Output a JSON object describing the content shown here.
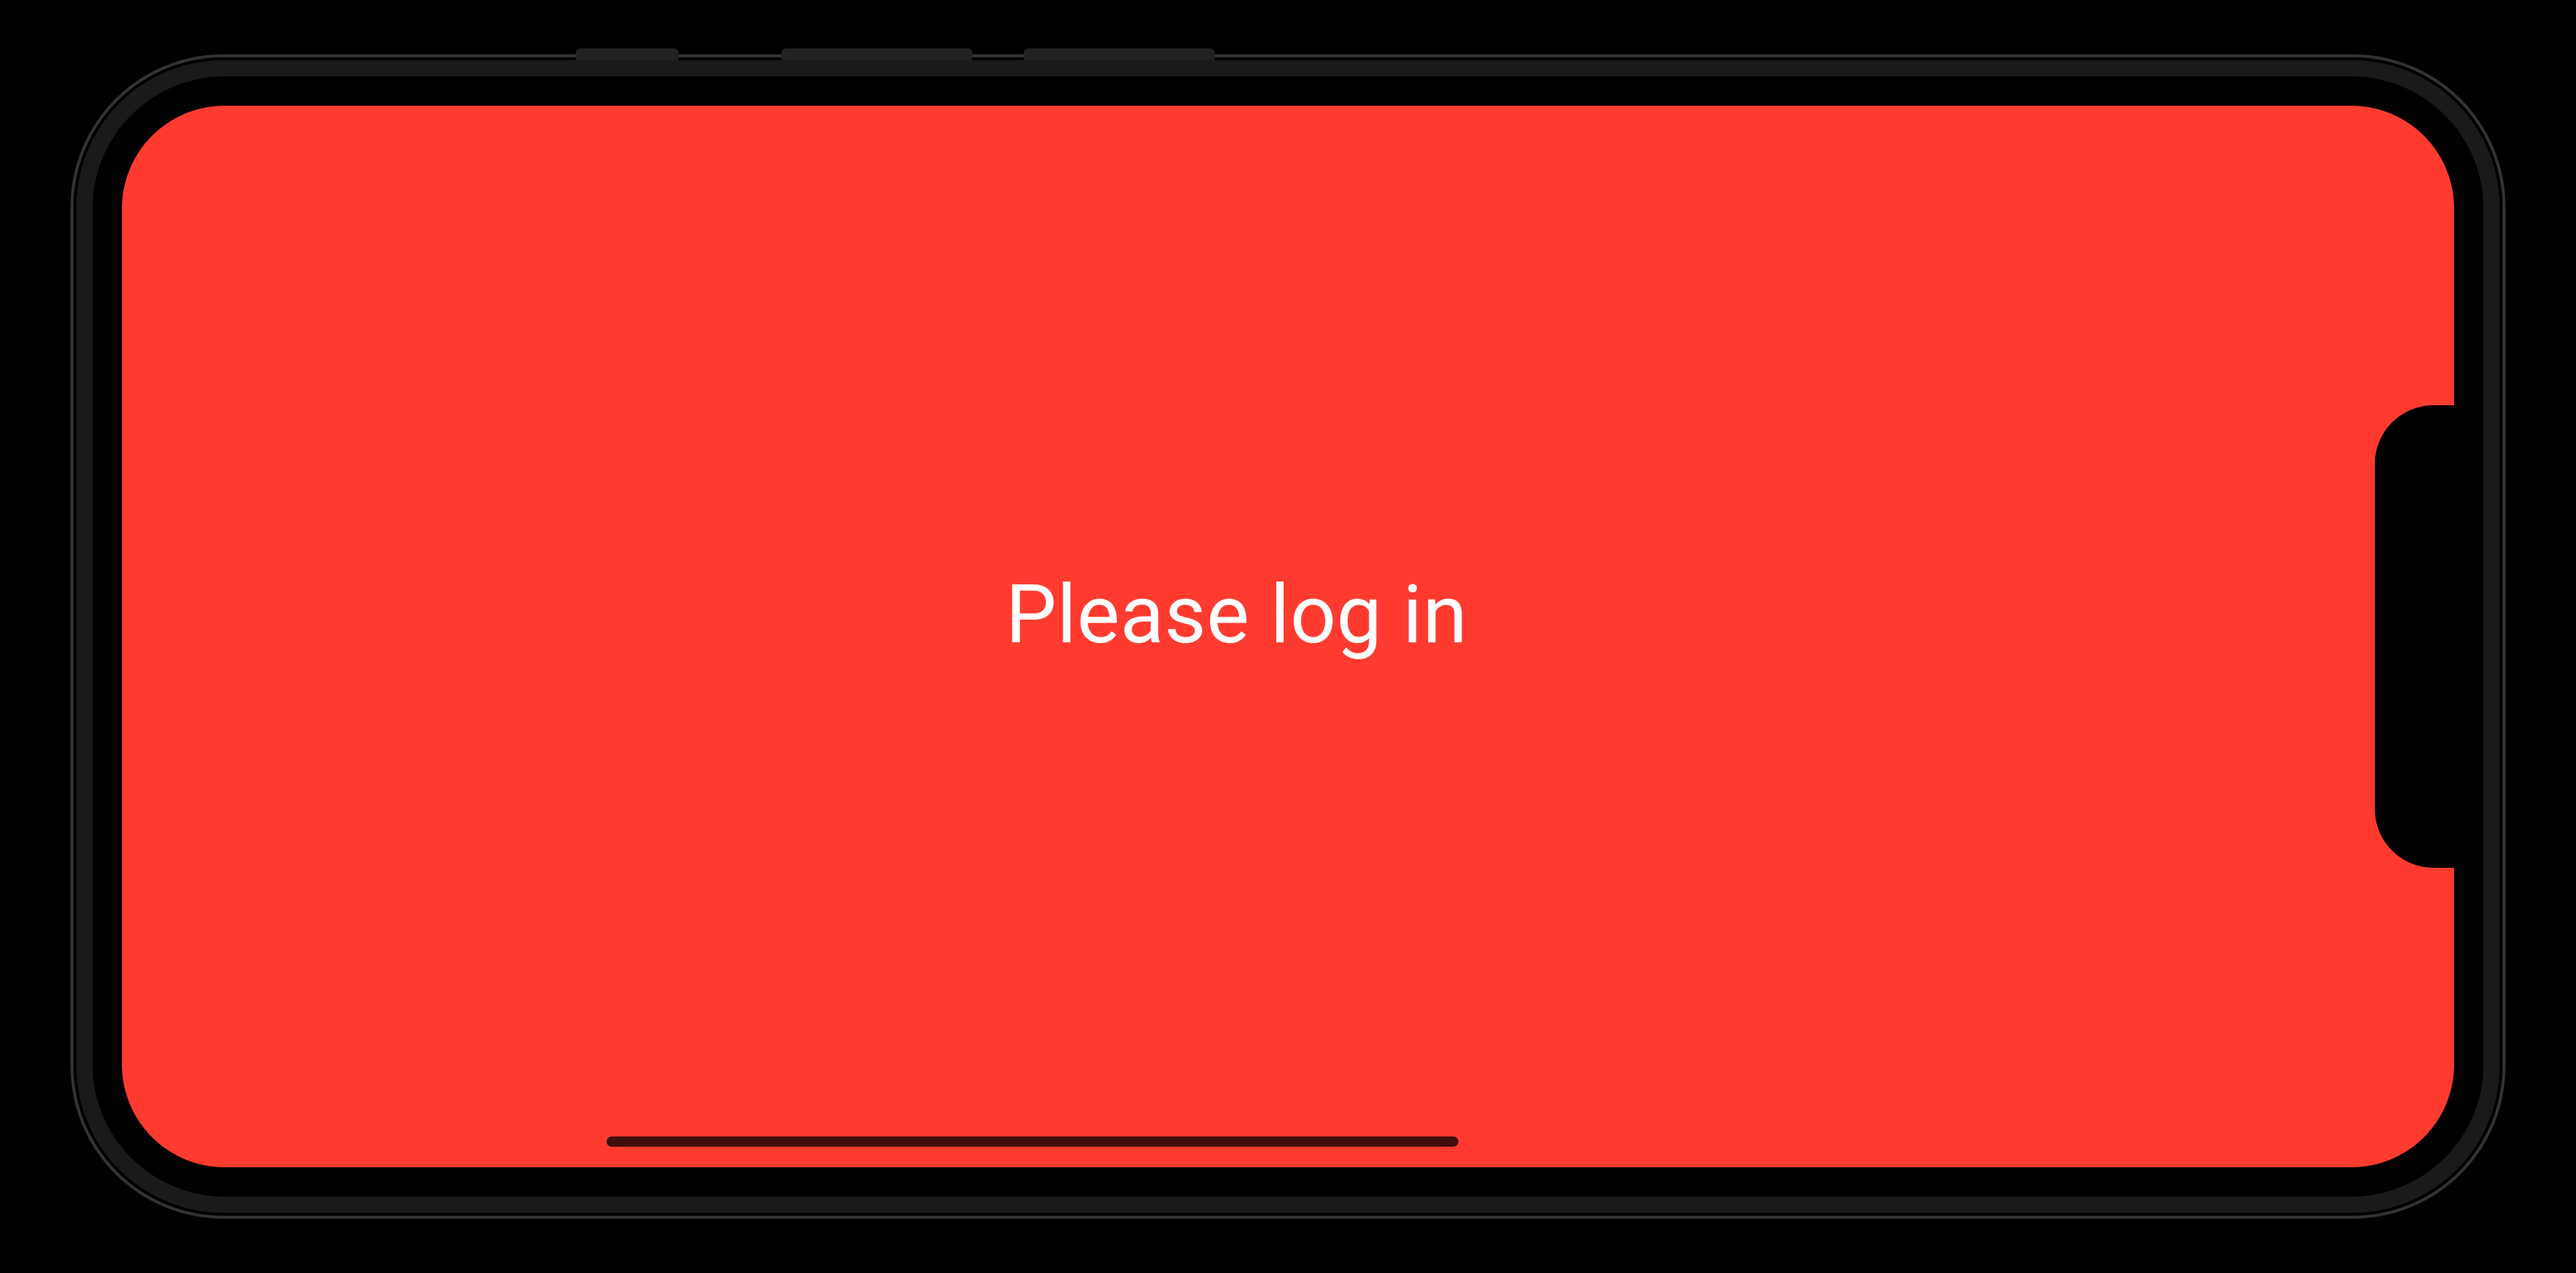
{
  "screen": {
    "message": "Please log in",
    "background_color": "#FF3B30",
    "text_color": "#FFFFFF"
  }
}
